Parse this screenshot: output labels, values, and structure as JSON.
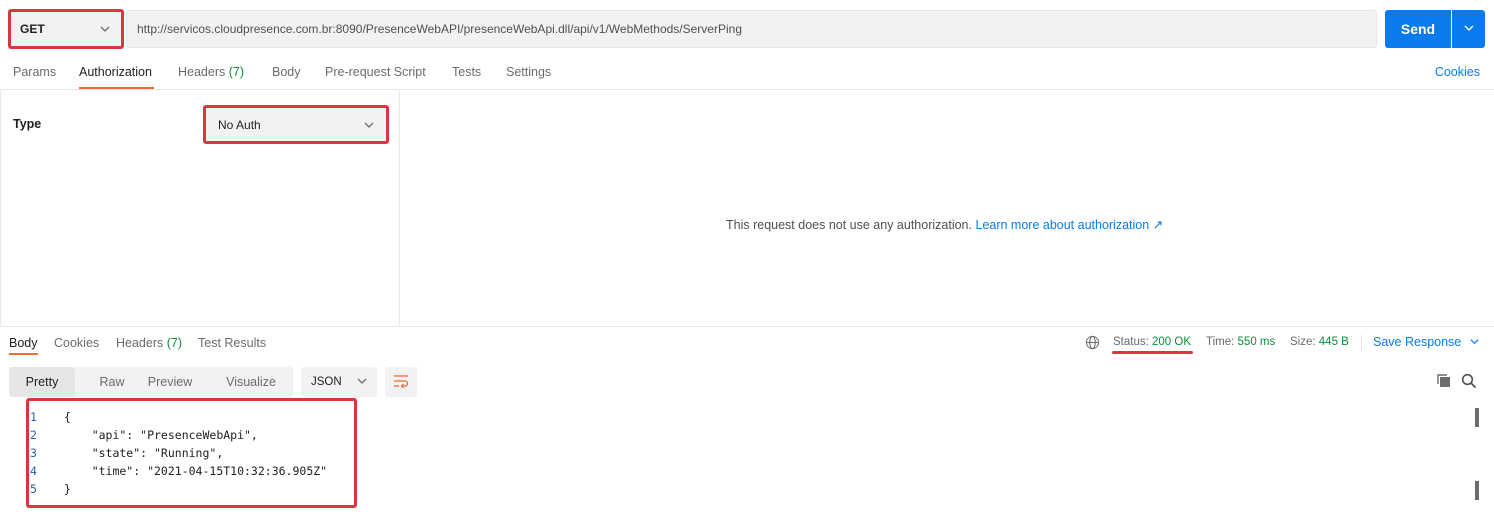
{
  "request": {
    "method": "GET",
    "url": "http://servicos.cloudpresence.com.br:8090/PresenceWebAPI/presenceWebApi.dll/api/v1/WebMethods/ServerPing",
    "send_label": "Send"
  },
  "request_tabs": {
    "params": "Params",
    "authorization": "Authorization",
    "headers": "Headers",
    "headers_count": "(7)",
    "body": "Body",
    "prerequest": "Pre-request Script",
    "tests": "Tests",
    "settings": "Settings",
    "cookies": "Cookies"
  },
  "auth": {
    "type_label": "Type",
    "type_value": "No Auth",
    "message": "This request does not use any authorization.",
    "learn_more": "Learn more about authorization ↗"
  },
  "response_tabs": {
    "body": "Body",
    "cookies": "Cookies",
    "headers": "Headers",
    "headers_count": "(7)",
    "test_results": "Test Results"
  },
  "response_meta": {
    "status_label": "Status:",
    "status_value": "200 OK",
    "time_label": "Time:",
    "time_value": "550 ms",
    "size_label": "Size:",
    "size_value": "445 B",
    "save_response": "Save Response"
  },
  "view_modes": [
    "Pretty",
    "Raw",
    "Preview",
    "Visualize"
  ],
  "format": "JSON",
  "code_lines": [
    {
      "num": "1",
      "text": "{"
    },
    {
      "num": "2",
      "text": "    \"api\": \"PresenceWebApi\","
    },
    {
      "num": "3",
      "text": "    \"state\": \"Running\","
    },
    {
      "num": "4",
      "text": "    \"time\": \"2021-04-15T10:32:36.905Z\""
    },
    {
      "num": "5",
      "text": "}"
    }
  ],
  "colors": {
    "accent": "#097bed",
    "highlight": "#d9363e",
    "tab_underline": "#f26b3a",
    "success": "#0c8c3c"
  }
}
